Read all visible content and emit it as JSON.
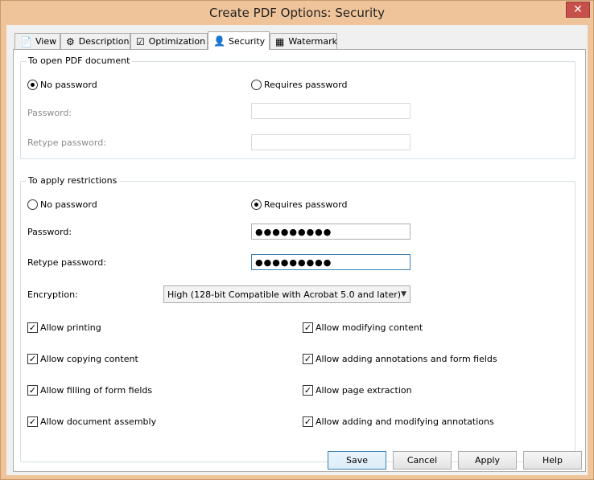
{
  "window": {
    "title": "Create PDF Options: Security",
    "close_label": "✕"
  },
  "tabs": [
    {
      "label": "View",
      "icon": "document-icon"
    },
    {
      "label": "Description",
      "icon": "gear-icon"
    },
    {
      "label": "Optimization",
      "icon": "checklist-icon"
    },
    {
      "label": "Security",
      "icon": "user-lock-icon"
    },
    {
      "label": "Watermark",
      "icon": "watermark-icon"
    }
  ],
  "open_group": {
    "title": "To open PDF document",
    "no_password": "No password",
    "requires_password": "Requires password",
    "selected": "no_password",
    "password_label": "Password:",
    "retype_label": "Retype password:",
    "password_value": "",
    "retype_value": ""
  },
  "restrict_group": {
    "title": "To apply restrictions",
    "no_password": "No password",
    "requires_password": "Requires password",
    "selected": "requires_password",
    "password_label": "Password:",
    "retype_label": "Retype password:",
    "password_value": "●●●●●●●●●",
    "retype_value": "●●●●●●●●●",
    "encryption_label": "Encryption:",
    "encryption_value": "High (128-bit Compatible with Acrobat 5.0 and later)",
    "permissions_left": [
      {
        "label": "Allow printing",
        "checked": true
      },
      {
        "label": "Allow copying content",
        "checked": true
      },
      {
        "label": "Allow filling of form fields",
        "checked": true
      },
      {
        "label": "Allow document assembly",
        "checked": true
      }
    ],
    "permissions_right": [
      {
        "label": "Allow modifying content",
        "checked": true
      },
      {
        "label": "Allow adding annotations and form fields",
        "checked": true
      },
      {
        "label": "Allow page extraction",
        "checked": true
      },
      {
        "label": "Allow adding and modifying annotations",
        "checked": true
      }
    ]
  },
  "buttons": {
    "save": "Save",
    "cancel": "Cancel",
    "apply": "Apply",
    "help": "Help"
  },
  "colors": {
    "frame": "#f0c49a",
    "close": "#c7504a",
    "focus": "#3c7fb1"
  }
}
